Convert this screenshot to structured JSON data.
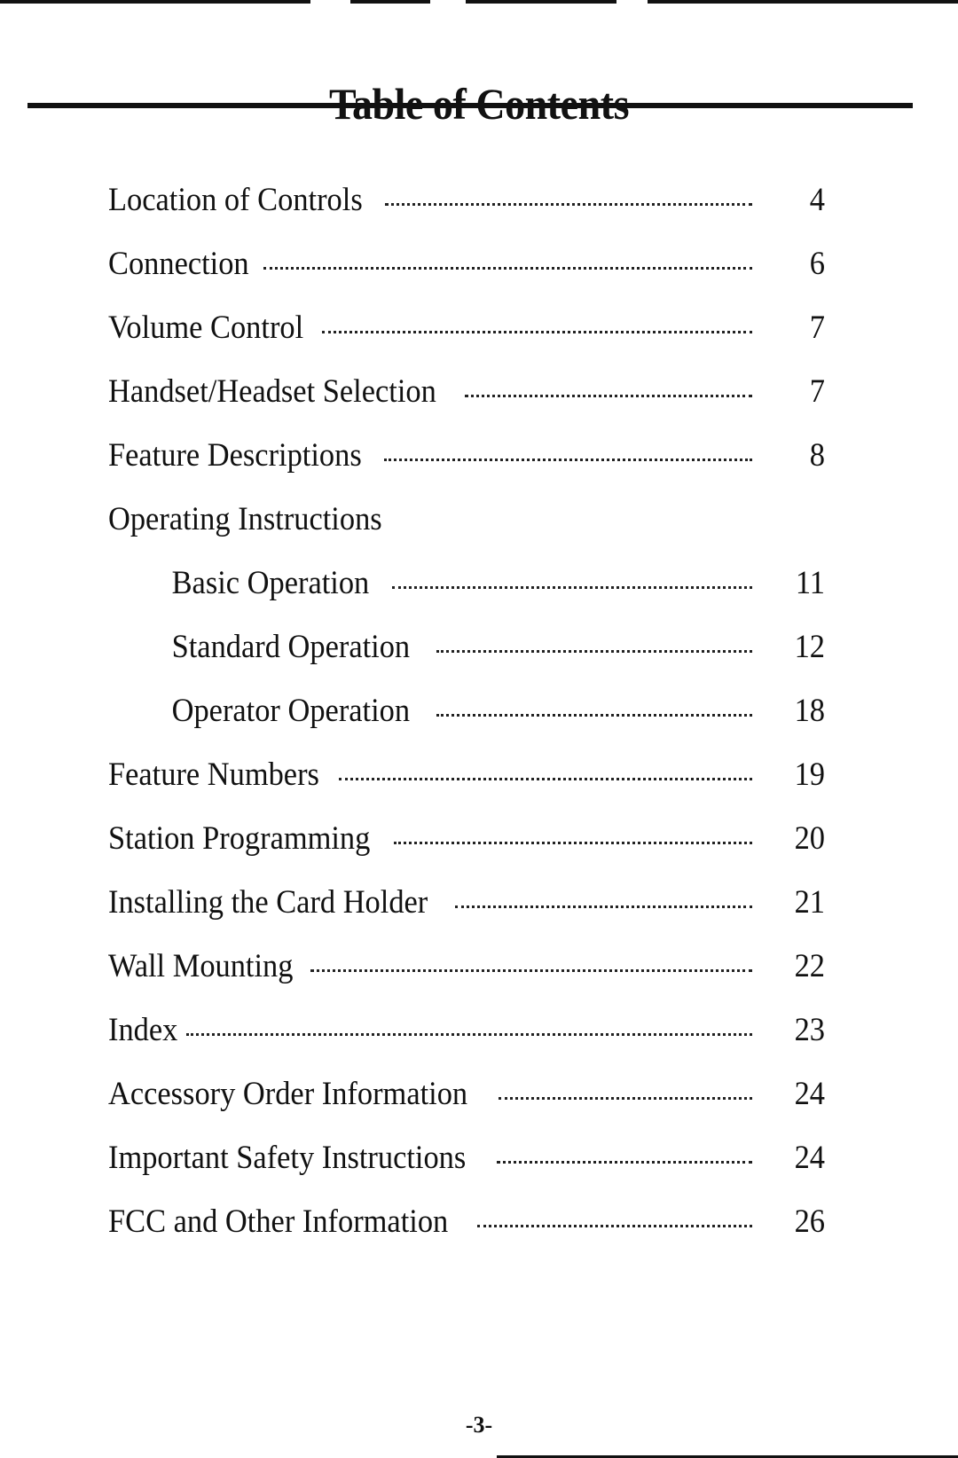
{
  "document": {
    "title": "Table of Contents",
    "page_number": "-3-"
  },
  "toc": [
    {
      "label": "Location of Controls",
      "page": "4",
      "level": 1
    },
    {
      "label": "Connection",
      "page": "6",
      "level": 1
    },
    {
      "label": "Volume Control",
      "page": "7",
      "level": 1
    },
    {
      "label": "Handset/Headset Selection",
      "page": "7",
      "level": 1
    },
    {
      "label": "Feature Descriptions",
      "page": "8",
      "level": 1
    },
    {
      "label": "Operating Instructions",
      "page": "",
      "level": 1
    },
    {
      "label": "Basic Operation",
      "page": "11",
      "level": 2
    },
    {
      "label": "Standard Operation",
      "page": "12",
      "level": 2
    },
    {
      "label": "Operator Operation",
      "page": "18",
      "level": 2
    },
    {
      "label": "Feature Numbers",
      "page": "19",
      "level": 1
    },
    {
      "label": "Station Programming",
      "page": "20",
      "level": 1
    },
    {
      "label": "Installing the Card Holder",
      "page": "21",
      "level": 1
    },
    {
      "label": "Wall Mounting",
      "page": "22",
      "level": 1
    },
    {
      "label": "Index",
      "page": "23",
      "level": 1
    },
    {
      "label": "Accessory Order Information",
      "page": "24",
      "level": 1
    },
    {
      "label": "Important Safety Instructions",
      "page": "24",
      "level": 1
    },
    {
      "label": "FCC and Other Information",
      "page": "26",
      "level": 1
    }
  ]
}
